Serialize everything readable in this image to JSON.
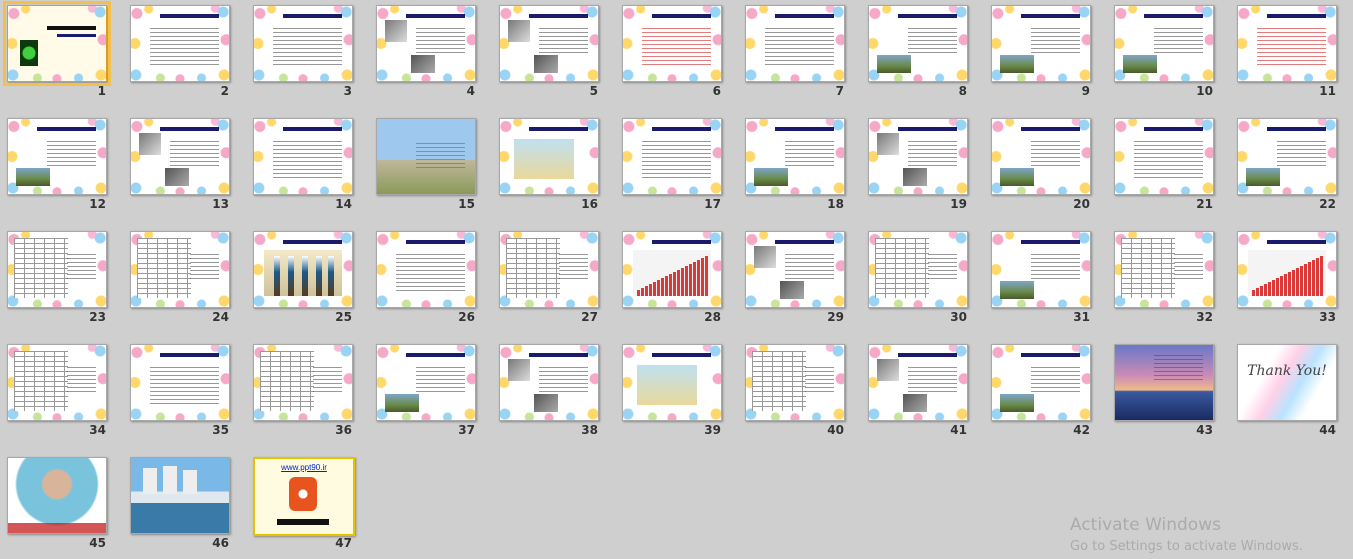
{
  "sorter": {
    "slide_count": 47,
    "selected_slide": 1,
    "slides": [
      {
        "num": "1",
        "style": "title"
      },
      {
        "num": "2",
        "style": "list"
      },
      {
        "num": "3",
        "style": "list"
      },
      {
        "num": "4",
        "style": "pics"
      },
      {
        "num": "5",
        "style": "pics"
      },
      {
        "num": "6",
        "style": "red"
      },
      {
        "num": "7",
        "style": "list"
      },
      {
        "num": "8",
        "style": "photo"
      },
      {
        "num": "9",
        "style": "photo"
      },
      {
        "num": "10",
        "style": "photo"
      },
      {
        "num": "11",
        "style": "red"
      },
      {
        "num": "12",
        "style": "photo"
      },
      {
        "num": "13",
        "style": "pics"
      },
      {
        "num": "14",
        "style": "list"
      },
      {
        "num": "15",
        "style": "landscape"
      },
      {
        "num": "16",
        "style": "diagram"
      },
      {
        "num": "17",
        "style": "list"
      },
      {
        "num": "18",
        "style": "photo"
      },
      {
        "num": "19",
        "style": "pics"
      },
      {
        "num": "20",
        "style": "photo"
      },
      {
        "num": "21",
        "style": "red"
      },
      {
        "num": "22",
        "style": "photo"
      },
      {
        "num": "23",
        "style": "table"
      },
      {
        "num": "24",
        "style": "table"
      },
      {
        "num": "25",
        "style": "bars"
      },
      {
        "num": "26",
        "style": "list"
      },
      {
        "num": "27",
        "style": "table"
      },
      {
        "num": "28",
        "style": "chart"
      },
      {
        "num": "29",
        "style": "pics"
      },
      {
        "num": "30",
        "style": "table"
      },
      {
        "num": "31",
        "style": "photo"
      },
      {
        "num": "32",
        "style": "table"
      },
      {
        "num": "33",
        "style": "chart"
      },
      {
        "num": "34",
        "style": "table"
      },
      {
        "num": "35",
        "style": "list"
      },
      {
        "num": "36",
        "style": "table"
      },
      {
        "num": "37",
        "style": "photo"
      },
      {
        "num": "38",
        "style": "pics"
      },
      {
        "num": "39",
        "style": "diagram"
      },
      {
        "num": "40",
        "style": "table"
      },
      {
        "num": "41",
        "style": "pics"
      },
      {
        "num": "42",
        "style": "photo"
      },
      {
        "num": "43",
        "style": "sunset"
      },
      {
        "num": "44",
        "style": "thankyou"
      },
      {
        "num": "45",
        "style": "portrait"
      },
      {
        "num": "46",
        "style": "towers"
      },
      {
        "num": "47",
        "style": "logo"
      }
    ]
  },
  "slide_text": {
    "thank_you": "Thank You!",
    "website": "www.ppt90.ir"
  },
  "watermark": {
    "line1": "Activate Windows",
    "line2": "Go to Settings to activate Windows."
  },
  "colors": {
    "background": "#cfcfcf",
    "selection": "#f2c04b",
    "title_bar": "#1b1b6e"
  }
}
